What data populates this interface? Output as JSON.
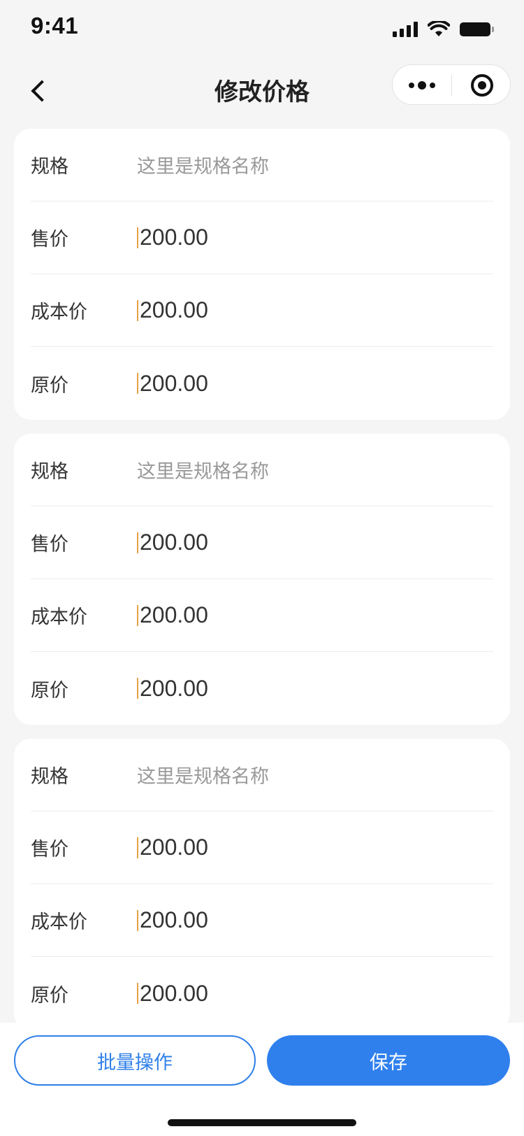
{
  "status_bar": {
    "time": "9:41"
  },
  "nav": {
    "title": "修改价格",
    "back_icon": "chevron-left-icon",
    "more_icon": "more-dots-icon",
    "close_icon": "target-circle-icon"
  },
  "colors": {
    "primary": "#2f80ed",
    "caret": "#e9a048",
    "background": "#f5f5f5"
  },
  "cards": [
    {
      "rows": [
        {
          "label": "规格",
          "value": "这里是规格名称",
          "kind": "text"
        },
        {
          "label": "售价",
          "value": "200.00",
          "kind": "input"
        },
        {
          "label": "成本价",
          "value": "200.00",
          "kind": "input"
        },
        {
          "label": "原价",
          "value": "200.00",
          "kind": "input"
        }
      ]
    },
    {
      "rows": [
        {
          "label": "规格",
          "value": "这里是规格名称",
          "kind": "text"
        },
        {
          "label": "售价",
          "value": "200.00",
          "kind": "input"
        },
        {
          "label": "成本价",
          "value": "200.00",
          "kind": "input"
        },
        {
          "label": "原价",
          "value": "200.00",
          "kind": "input"
        }
      ]
    },
    {
      "rows": [
        {
          "label": "规格",
          "value": "这里是规格名称",
          "kind": "text"
        },
        {
          "label": "售价",
          "value": "200.00",
          "kind": "input"
        },
        {
          "label": "成本价",
          "value": "200.00",
          "kind": "input"
        },
        {
          "label": "原价",
          "value": "200.00",
          "kind": "input"
        }
      ]
    }
  ],
  "footer": {
    "batch_label": "批量操作",
    "save_label": "保存"
  }
}
